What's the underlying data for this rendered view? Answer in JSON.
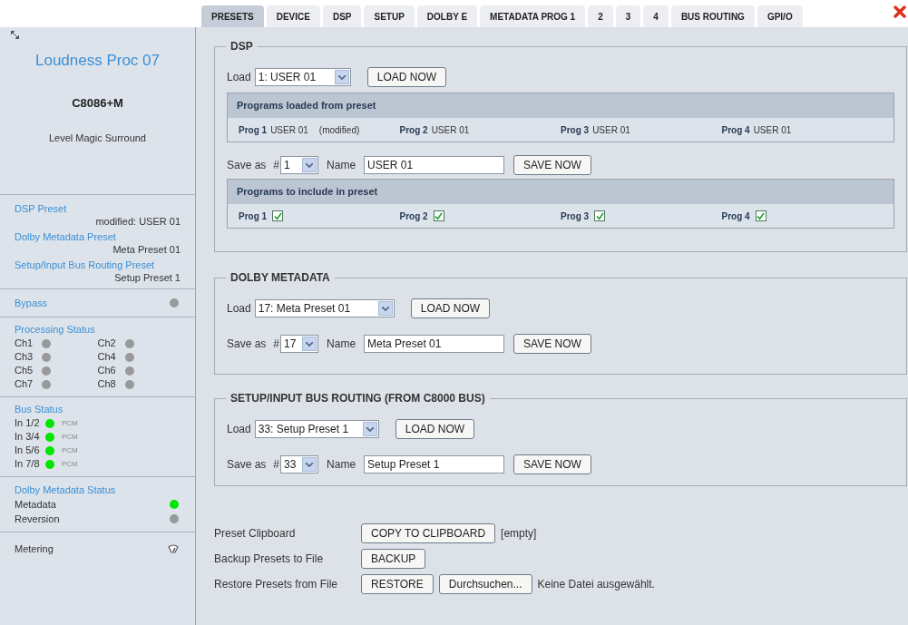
{
  "tabs": [
    {
      "label": "PRESETS",
      "selected": true
    },
    {
      "label": "DEVICE",
      "selected": false
    },
    {
      "label": "DSP",
      "selected": false
    },
    {
      "label": "SETUP",
      "selected": false
    },
    {
      "label": "DOLBY E",
      "selected": false
    },
    {
      "label": "METADATA PROG 1",
      "selected": false
    },
    {
      "label": "2",
      "selected": false
    },
    {
      "label": "3",
      "selected": false
    },
    {
      "label": "4",
      "selected": false
    },
    {
      "label": "BUS ROUTING",
      "selected": false
    },
    {
      "label": "GPI/O",
      "selected": false
    }
  ],
  "sidebar": {
    "title": "Loudness Proc 07",
    "model": "C8086+M",
    "product": "Level Magic Surround",
    "presets": [
      {
        "heading": "DSP Preset",
        "current": "modified: USER 01"
      },
      {
        "heading": "Dolby Metadata Preset",
        "current": "Meta Preset 01"
      },
      {
        "heading": "Setup/Input Bus Routing Preset",
        "current": "Setup Preset 1"
      }
    ],
    "bypass": {
      "label": "Bypass",
      "color": "#999999"
    },
    "processing_status": {
      "title": "Processing Status",
      "channels": [
        {
          "label": "Ch1",
          "color": "#999999"
        },
        {
          "label": "Ch2",
          "color": "#999999"
        },
        {
          "label": "Ch3",
          "color": "#999999"
        },
        {
          "label": "Ch4",
          "color": "#999999"
        },
        {
          "label": "Ch5",
          "color": "#999999"
        },
        {
          "label": "Ch6",
          "color": "#999999"
        },
        {
          "label": "Ch7",
          "color": "#999999"
        },
        {
          "label": "Ch8",
          "color": "#999999"
        }
      ]
    },
    "bus_status": {
      "title": "Bus Status",
      "inputs": [
        {
          "label": "In 1/2",
          "color": "#00e600",
          "format": "PCM"
        },
        {
          "label": "In 3/4",
          "color": "#00e600",
          "format": "PCM"
        },
        {
          "label": "In 5/6",
          "color": "#00e600",
          "format": "PCM"
        },
        {
          "label": "In 7/8",
          "color": "#00e600",
          "format": "PCM"
        }
      ]
    },
    "dolby_status": {
      "title": "Dolby Metadata Status",
      "items": [
        {
          "label": "Metadata",
          "color": "#00e600"
        },
        {
          "label": "Reversion",
          "color": "#999999"
        }
      ]
    },
    "metering": {
      "label": "Metering"
    }
  },
  "sections": [
    {
      "kind": "dsp",
      "title": "DSP",
      "load": {
        "label": "Load",
        "value": "1: USER 01",
        "button": "LOAD NOW"
      },
      "loaded": {
        "header": "Programs loaded from preset",
        "programs": [
          {
            "label": "Prog 1",
            "value": "USER 01",
            "note": "(modified)"
          },
          {
            "label": "Prog 2",
            "value": "USER 01"
          },
          {
            "label": "Prog 3",
            "value": "USER 01"
          },
          {
            "label": "Prog 4",
            "value": "USER 01"
          }
        ]
      },
      "save": {
        "label": "Save as",
        "hash": "#",
        "number": "1",
        "name_label": "Name",
        "name": "USER 01",
        "button": "SAVE NOW"
      },
      "include": {
        "header": "Programs to include in preset",
        "programs": [
          {
            "label": "Prog 1",
            "checked": true
          },
          {
            "label": "Prog 2",
            "checked": true
          },
          {
            "label": "Prog 3",
            "checked": true
          },
          {
            "label": "Prog 4",
            "checked": true
          }
        ]
      }
    },
    {
      "kind": "simple",
      "title": "DOLBY METADATA",
      "load": {
        "label": "Load",
        "value": "17: Meta Preset 01",
        "button": "LOAD NOW"
      },
      "save": {
        "label": "Save as",
        "hash": "#",
        "number": "17",
        "name_label": "Name",
        "name": "Meta Preset 01",
        "button": "SAVE NOW"
      }
    },
    {
      "kind": "simple",
      "title": "SETUP/INPUT BUS ROUTING (FROM C8000 BUS)",
      "load": {
        "label": "Load",
        "value": "33: Setup Preset 1",
        "button": "LOAD NOW"
      },
      "save": {
        "label": "Save as",
        "hash": "#",
        "number": "33",
        "name_label": "Name",
        "name": "Setup Preset 1",
        "button": "SAVE NOW"
      }
    }
  ],
  "file_actions": [
    {
      "label": "Preset Clipboard",
      "buttons": [
        "COPY TO CLIPBOARD"
      ],
      "note": "[empty]"
    },
    {
      "label": "Backup Presets to File",
      "buttons": [
        "BACKUP"
      ]
    },
    {
      "label": "Restore Presets from File",
      "buttons": [
        "RESTORE",
        "Durchsuchen..."
      ],
      "note": "Keine Datei ausgewählt."
    }
  ]
}
